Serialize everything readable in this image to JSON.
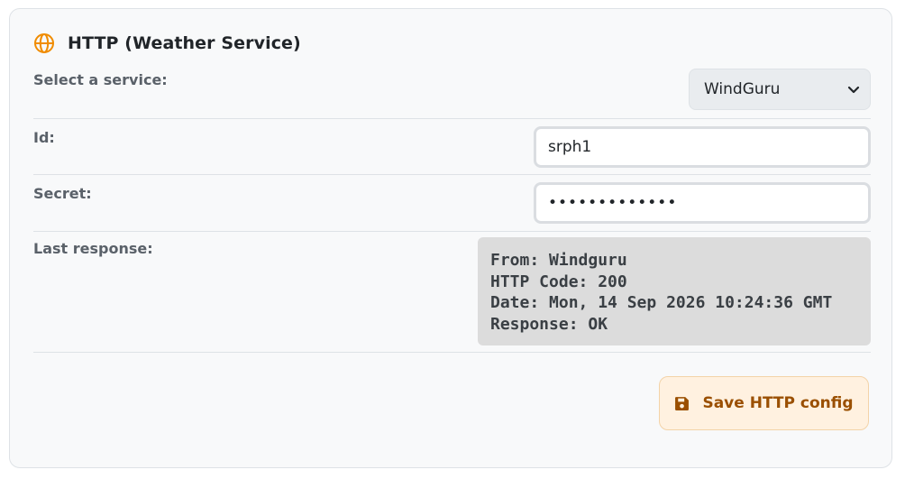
{
  "card": {
    "title": "HTTP (Weather Service)",
    "icon": "globe-icon",
    "accent_color": "#f08c00"
  },
  "service": {
    "label": "Select a service:",
    "selected": "WindGuru"
  },
  "id_field": {
    "label": "Id:",
    "value": "srph1"
  },
  "secret_field": {
    "label": "Secret:",
    "value": "•••••••••••••"
  },
  "last_response": {
    "label": "Last response:",
    "lines": [
      "From: Windguru",
      "HTTP Code: 200",
      "Date: Mon, 14 Sep 2026 10:24:36 GMT",
      "Response: OK"
    ]
  },
  "save_button": {
    "label": "Save HTTP config",
    "icon": "floppy-disk-icon"
  }
}
